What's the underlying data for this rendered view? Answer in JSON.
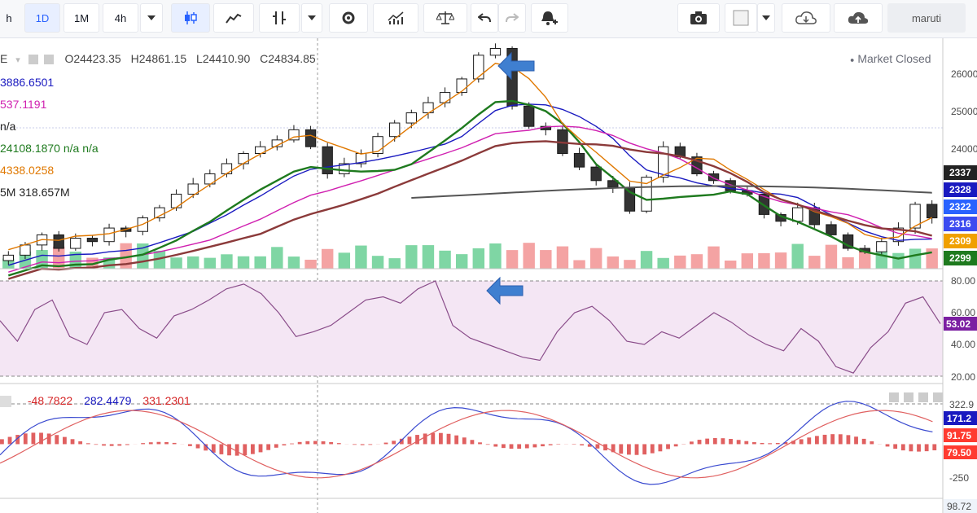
{
  "toolbar": {
    "intervals": [
      "h",
      "1D",
      "1M",
      "4h"
    ],
    "active_interval": "1D",
    "user": "maruti"
  },
  "legend": {
    "symbol_fragment": "E",
    "ohlc": {
      "o": "O",
      "o_val": "24423.35",
      "h": "H",
      "h_val": "24861.15",
      "l": "L",
      "l_val": "24410.90",
      "c": "C",
      "c_val": "24834.85"
    },
    "market_status": "Market Closed",
    "rows": [
      {
        "text": "3886.6501",
        "color": "#1a1ac0"
      },
      {
        "text": "537.1191",
        "color": "#d020b0"
      },
      {
        "text": "n/a",
        "color": "#222222"
      },
      {
        "text": "24108.1870  n/a  n/a",
        "color": "#1e7a1e"
      },
      {
        "text": "4338.0258",
        "color": "#e07800"
      },
      {
        "text": "5M   318.657M",
        "color": "#222222"
      }
    ]
  },
  "chart_data": [
    {
      "type": "candlestick",
      "title": "",
      "ylim": [
        22900,
        26300
      ],
      "y_ticks": [
        "26000",
        "25000",
        "24000"
      ],
      "ohlc_last": {
        "open": 24423.35,
        "high": 24861.15,
        "low": 24410.9,
        "close": 24834.85
      },
      "close_approx": [
        23100,
        23250,
        23400,
        23200,
        23350,
        23300,
        23500,
        23450,
        23650,
        23800,
        24000,
        24150,
        24300,
        24450,
        24600,
        24700,
        24800,
        24950,
        24700,
        24300,
        24450,
        24600,
        24850,
        25050,
        25200,
        25350,
        25500,
        25700,
        26050,
        26150,
        25300,
        25000,
        24950,
        24600,
        24400,
        24200,
        24100,
        23750,
        24250,
        24700,
        24550,
        24300,
        24200,
        24050,
        24000,
        23700,
        23600,
        23800,
        23550,
        23400,
        23200,
        23150,
        23300,
        23500,
        23850,
        23650
      ],
      "series": [
        {
          "name": "",
          "color": "#1a1ac0",
          "last": 23289
        },
        {
          "name": "",
          "color": "#d020b0",
          "last": 23229
        },
        {
          "name": "",
          "color": "#1e7a1e",
          "last": 23168
        },
        {
          "name": "",
          "color": "#e07800",
          "last": 23093
        },
        {
          "name": "",
          "color": "#8b3a3a",
          "last": 23373
        }
      ],
      "price_tags": [
        {
          "text": "2337",
          "color": "#222222"
        },
        {
          "text": "2328",
          "color": "#1a1ac0"
        },
        {
          "text": "2322",
          "color": "#2962ff"
        },
        {
          "text": "2316",
          "color": "#3c4bf0"
        },
        {
          "text": "2309",
          "color": "#f0a000"
        },
        {
          "text": "2299",
          "color": "#1e7a1e"
        }
      ]
    },
    {
      "type": "line",
      "title": "",
      "ylim": [
        20,
        80
      ],
      "y_ticks": [
        "80.00",
        "60.00",
        "40.00",
        "20.00"
      ],
      "last_value": "53.02",
      "values": [
        55,
        42,
        62,
        68,
        45,
        40,
        60,
        62,
        50,
        44,
        58,
        62,
        68,
        75,
        78,
        72,
        60,
        45,
        48,
        52,
        60,
        68,
        70,
        66,
        75,
        80,
        52,
        44,
        40,
        36,
        32,
        30,
        48,
        60,
        64,
        55,
        42,
        40,
        48,
        44,
        52,
        60,
        54,
        46,
        40,
        36,
        50,
        42,
        26,
        22,
        38,
        48,
        66,
        70,
        53
      ]
    },
    {
      "type": "bar",
      "title": "",
      "legend_values": [
        "-48.7822",
        "282.4479",
        "331.2301"
      ],
      "legend_colors": [
        "#d62728",
        "#1a1ac0",
        "#d62728"
      ],
      "ylim": [
        -380,
        420
      ],
      "y_ticks": [
        "322.9",
        "-250"
      ],
      "tag_values": [
        {
          "text": "171.2",
          "color": "#1a1ac0"
        },
        {
          "text": "91.75",
          "color": "#ff3b30"
        },
        {
          "text": "79.50",
          "color": "#ff3b30"
        }
      ],
      "bottom_tag": "98.72"
    }
  ]
}
